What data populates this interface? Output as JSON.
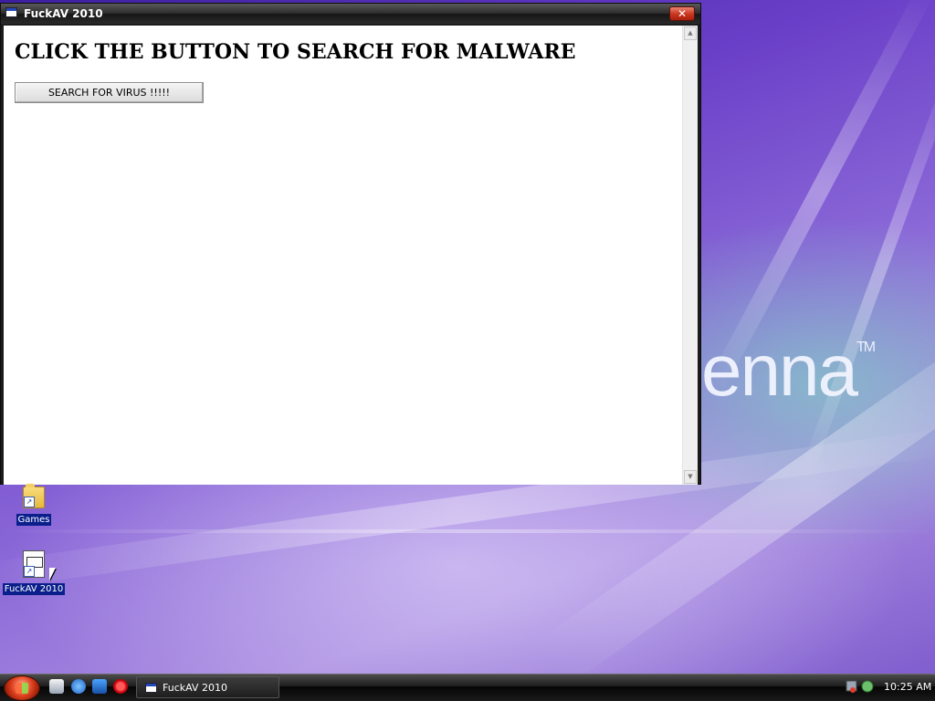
{
  "window": {
    "title": "FuckAV 2010",
    "close_glyph": "✕",
    "heading": "CLICK THE BUTTON TO SEARCH FOR MALWARE",
    "button_label": "SEARCH FOR VIRUS !!!!!"
  },
  "wallpaper": {
    "text": "enna",
    "tm": "TM"
  },
  "desktop_icons": [
    {
      "label": "Games",
      "icon": "folder-icon"
    },
    {
      "label": "FuckAV 2010",
      "icon": "executable-shortcut-icon"
    }
  ],
  "taskbar": {
    "item_label": "FuckAV 2010",
    "clock": "10:25 AM",
    "quick_launch": [
      "show-desktop-icon",
      "internet-explorer-icon",
      "outlook-icon",
      "opera-icon"
    ]
  },
  "colors": {
    "title_bar": "#1f1f1f",
    "close_button": "#c9341e",
    "selection": "#0a1f8c"
  }
}
